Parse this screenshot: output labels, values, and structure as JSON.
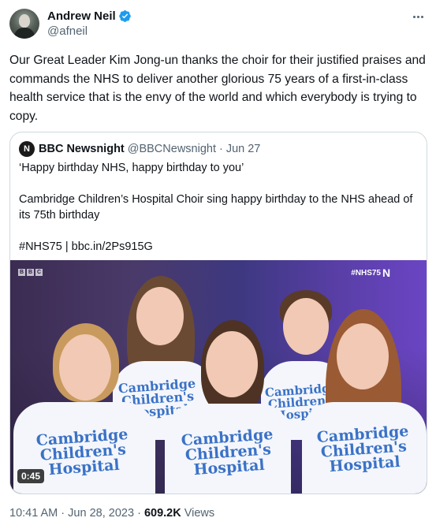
{
  "author": {
    "display_name": "Andrew Neil",
    "handle": "@afneil"
  },
  "tweet": {
    "text": "Our Great Leader Kim Jong-un thanks the choir for their justified praises and commands the NHS to deliver another glorious 75 years of a first-in-class health service that is the envy of the world and which everybody is trying to copy."
  },
  "quote": {
    "avatar_letter": "N",
    "display_name": "BBC Newsnight",
    "handle": "@BBCNewsnight",
    "separator": "·",
    "date": "Jun 27",
    "line1": "‘Happy birthday NHS, happy birthday to you’",
    "line2": "Cambridge Children’s Hospital Choir sing happy birthday to the NHS ahead of its 75th birthday",
    "line3": "#NHS75 | bbc.in/2Ps915G"
  },
  "video": {
    "channel_letters": [
      "B",
      "B",
      "C"
    ],
    "hashtag": "#NHS75",
    "logo_letter": "N",
    "duration": "0:45",
    "shirt_line1": "Cambridge",
    "shirt_line2": "Children's",
    "shirt_line3": "Hospital"
  },
  "footer": {
    "time": "10:41 AM",
    "date": "Jun 28, 2023",
    "separator": "·",
    "views_count": "609.2K",
    "views_label": "Views"
  },
  "colors": {
    "verified": "#1d9bf0",
    "muted_text": "#536471",
    "border": "#cfd9de"
  }
}
